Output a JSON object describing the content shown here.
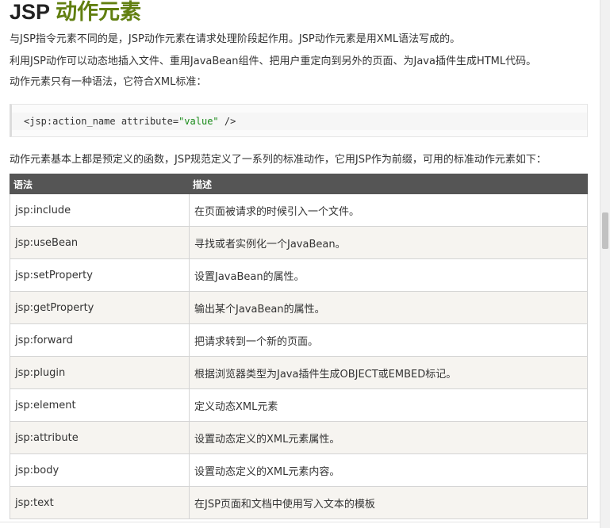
{
  "title": {
    "prefix": "JSP",
    "accent": "动作元素"
  },
  "paragraphs": [
    "与JSP指令元素不同的是，JSP动作元素在请求处理阶段起作用。JSP动作元素是用XML语法写成的。",
    "利用JSP动作可以动态地插入文件、重用JavaBean组件、把用户重定向到另外的页面、为Java插件生成HTML代码。",
    "动作元素只有一种语法，它符合XML标准："
  ],
  "code": {
    "prefix": "<jsp:action_name attribute=",
    "string": "\"value\"",
    "suffix": " />"
  },
  "intro": "动作元素基本上都是预定义的函数，JSP规范定义了一系列的标准动作，它用JSP作为前缀，可用的标准动作元素如下：",
  "table": {
    "headers": [
      "语法",
      "描述"
    ],
    "rows": [
      [
        "jsp:include",
        "在页面被请求的时候引入一个文件。"
      ],
      [
        "jsp:useBean",
        "寻找或者实例化一个JavaBean。"
      ],
      [
        "jsp:setProperty",
        "设置JavaBean的属性。"
      ],
      [
        "jsp:getProperty",
        "输出某个JavaBean的属性。"
      ],
      [
        "jsp:forward",
        "把请求转到一个新的页面。"
      ],
      [
        "jsp:plugin",
        "根据浏览器类型为Java插件生成OBJECT或EMBED标记。"
      ],
      [
        "jsp:element",
        "定义动态XML元素"
      ],
      [
        "jsp:attribute",
        "设置动态定义的XML元素属性。"
      ],
      [
        "jsp:body",
        "设置动态定义的XML元素内容。"
      ],
      [
        "jsp:text",
        "在JSP页面和文档中使用写入文本的模板"
      ]
    ]
  },
  "colors": {
    "accent": "#617f10",
    "header_bg": "#555555",
    "alt_row": "#f6f4f0"
  }
}
